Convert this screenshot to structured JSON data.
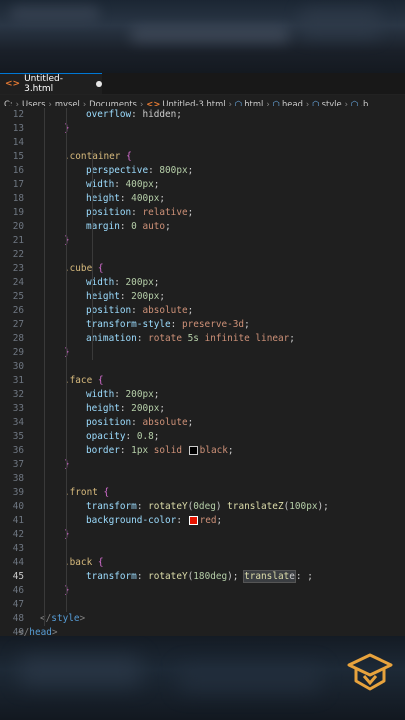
{
  "tab": {
    "title": "Untitled-3.html"
  },
  "breadcrumb": [
    "C:",
    "Users",
    "mysel",
    "Documents",
    "Untitled-3.html",
    "html",
    "head",
    "style",
    ".b"
  ],
  "lines": [
    {
      "n": "12",
      "t": "overflow: hidden;"
    },
    {
      "n": "13",
      "t": "}"
    },
    {
      "n": "14",
      "t": ""
    },
    {
      "n": "15",
      "t": ".container {"
    },
    {
      "n": "16",
      "t": "perspective: 800px;"
    },
    {
      "n": "17",
      "t": "width: 400px;"
    },
    {
      "n": "18",
      "t": "height: 400px;"
    },
    {
      "n": "19",
      "t": "position: relative;"
    },
    {
      "n": "20",
      "t": "margin: 0 auto;"
    },
    {
      "n": "21",
      "t": "}"
    },
    {
      "n": "22",
      "t": ""
    },
    {
      "n": "23",
      "t": ".cube {"
    },
    {
      "n": "24",
      "t": "width: 200px;"
    },
    {
      "n": "25",
      "t": "height: 200px;"
    },
    {
      "n": "26",
      "t": "position: absolute;"
    },
    {
      "n": "27",
      "t": "transform-style: preserve-3d;"
    },
    {
      "n": "28",
      "t": "animation: rotate 5s infinite linear;"
    },
    {
      "n": "29",
      "t": "}"
    },
    {
      "n": "30",
      "t": ""
    },
    {
      "n": "31",
      "t": ".face {"
    },
    {
      "n": "32",
      "t": "width: 200px;"
    },
    {
      "n": "33",
      "t": "height: 200px;"
    },
    {
      "n": "34",
      "t": "position: absolute;"
    },
    {
      "n": "35",
      "t": "opacity: 0.8;"
    },
    {
      "n": "36",
      "t": "border: 1px solid black;"
    },
    {
      "n": "37",
      "t": "}"
    },
    {
      "n": "38",
      "t": ""
    },
    {
      "n": "39",
      "t": ".front {"
    },
    {
      "n": "40",
      "t": "transform: rotateY(0deg) translateZ(100px);"
    },
    {
      "n": "41",
      "t": "background-color: red;"
    },
    {
      "n": "42",
      "t": "}"
    },
    {
      "n": "43",
      "t": ""
    },
    {
      "n": "44",
      "t": ".back {"
    },
    {
      "n": "45",
      "t": "transform: rotateY(180deg); translate: ;"
    },
    {
      "n": "46",
      "t": "}"
    },
    {
      "n": "47",
      "t": ""
    },
    {
      "n": "48",
      "t": "</style>"
    },
    {
      "n": "49",
      "t": "</head>"
    }
  ],
  "colors": {
    "selector": "#d7ba7d",
    "property": "#9cdcfe",
    "value": "#ce9178",
    "number": "#b5cea8",
    "function": "#dcdcaa",
    "tag": "#569cd6",
    "tab_accent": "#0078d4",
    "swatch_black": "#000000",
    "swatch_red": "#e51400"
  },
  "logo_icon": "graduation-cap-icon"
}
